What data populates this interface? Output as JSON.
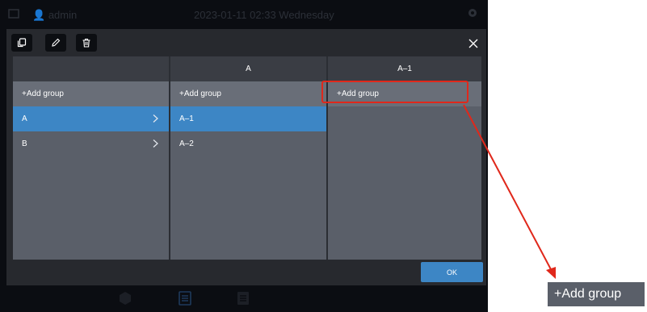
{
  "topbar": {
    "user": "admin",
    "datetime": "2023-01-11 02:33 Wednesday"
  },
  "toolbar": {
    "icons": [
      "copy-icon",
      "edit-icon",
      "delete-icon"
    ],
    "close_icon": "close-icon"
  },
  "columns": [
    {
      "header": "",
      "add_label": "+Add group",
      "items": [
        {
          "label": "A",
          "selected": true,
          "has_children": true
        },
        {
          "label": "B",
          "selected": false,
          "has_children": true
        }
      ]
    },
    {
      "header": "A",
      "add_label": "+Add group",
      "items": [
        {
          "label": "A–1",
          "selected": true,
          "has_children": false
        },
        {
          "label": "A–2",
          "selected": false,
          "has_children": false
        }
      ]
    },
    {
      "header": "A–1",
      "add_label": "+Add group",
      "items": []
    }
  ],
  "footer": {
    "ok_label": "OK"
  },
  "callout": {
    "label": "+Add group"
  },
  "colors": {
    "accent": "#3d86c5",
    "highlight": "#e0281b",
    "panel": "#5a5f69",
    "add_row": "#696e78"
  }
}
